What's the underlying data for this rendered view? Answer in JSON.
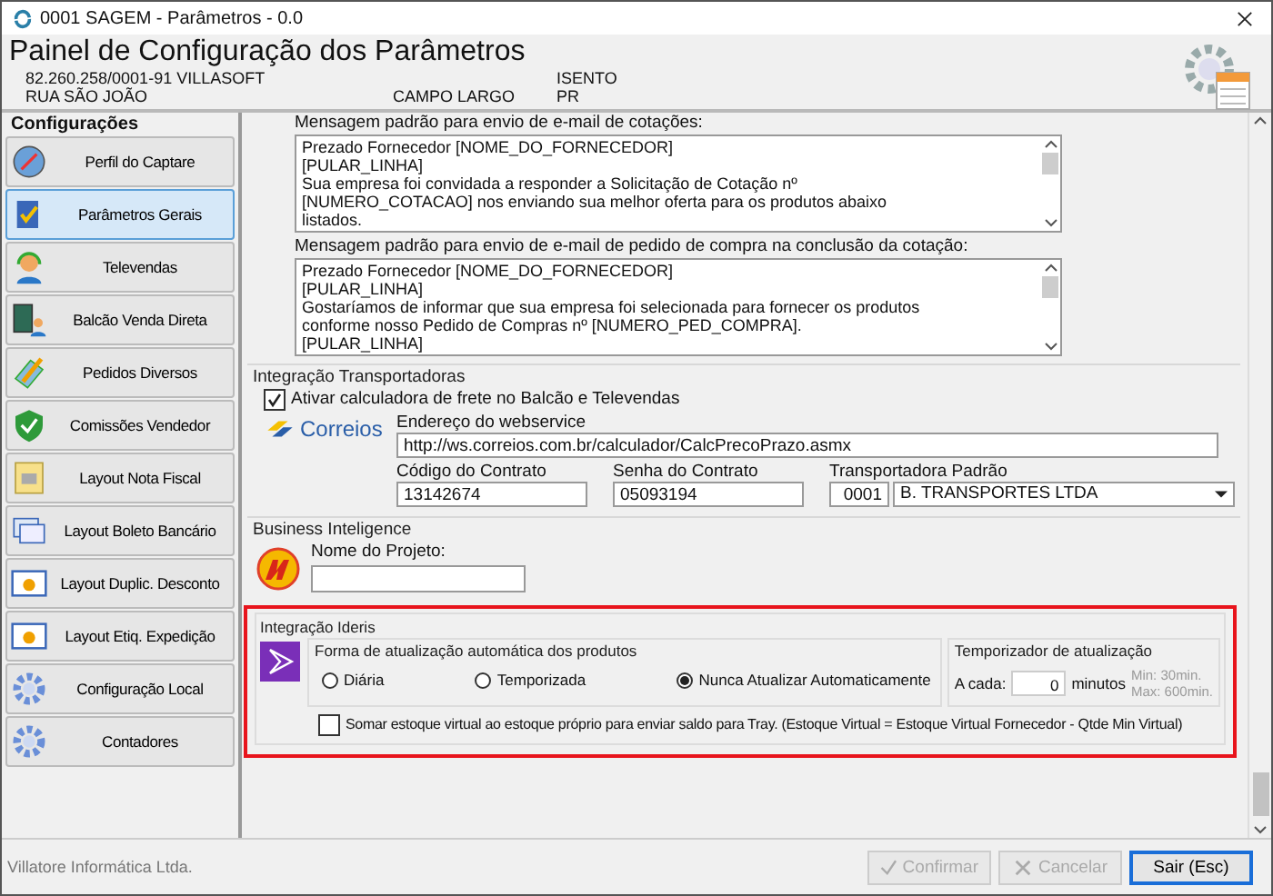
{
  "window": {
    "title": "0001 SAGEM - Parâmetros - 0.0"
  },
  "header": {
    "title": "Painel de Configuração dos Parâmetros",
    "company_id": "82.260.258/0001-91",
    "company_name": "VILLASOFT",
    "tax_status": "ISENTO",
    "street": "RUA SÃO JOÃO",
    "city": "CAMPO LARGO",
    "state": "PR"
  },
  "sidebar": {
    "title": "Configurações",
    "items": [
      {
        "label": "Perfil do Captare",
        "selected": false
      },
      {
        "label": "Parâmetros Gerais",
        "selected": true
      },
      {
        "label": "Televendas",
        "selected": false
      },
      {
        "label": "Balcão Venda Direta",
        "selected": false
      },
      {
        "label": "Pedidos Diversos",
        "selected": false
      },
      {
        "label": "Comissões Vendedor",
        "selected": false
      },
      {
        "label": "Layout Nota Fiscal",
        "selected": false
      },
      {
        "label": "Layout Boleto Bancário",
        "selected": false
      },
      {
        "label": "Layout Duplic. Desconto",
        "selected": false
      },
      {
        "label": "Layout Etiq. Expedição",
        "selected": false
      },
      {
        "label": "Configuração Local",
        "selected": false
      },
      {
        "label": "Contadores",
        "selected": false
      }
    ]
  },
  "messages": [
    {
      "label": "Mensagem padrão para envio de e-mail de cotações:",
      "lines": [
        "Prezado Fornecedor [NOME_DO_FORNECEDOR]",
        "[PULAR_LINHA]",
        "Sua empresa foi convidada a responder a Solicitação de Cotação nº",
        "[NUMERO_COTACAO] nos enviando sua melhor oferta para os produtos abaixo",
        "listados."
      ]
    },
    {
      "label": "Mensagem padrão para envio de e-mail de pedido de compra na conclusão da cotação:",
      "lines": [
        "Prezado Fornecedor [NOME_DO_FORNECEDOR]",
        "[PULAR_LINHA]",
        "Gostaríamos de informar que sua empresa foi selecionada para fornecer os produtos",
        "conforme nosso Pedido de Compras nº [NUMERO_PED_COMPRA].",
        "[PULAR_LINHA]"
      ]
    }
  ],
  "shipping": {
    "title": "Integração Transportadoras",
    "calculator": {
      "label": "Ativar calculadora de frete no Balcão e Televendas",
      "checked": true
    },
    "logo_text": "Correios",
    "webservice": {
      "label": "Endereço do webservice",
      "value": "http://ws.correios.com.br/calculador/CalcPrecoPrazo.asmx"
    },
    "contract_code": {
      "label": "Código do Contrato",
      "value": "13142674"
    },
    "contract_password": {
      "label": "Senha do Contrato",
      "value": "05093194"
    },
    "default_carrier": {
      "label": "Transportadora Padrão",
      "code": "0001",
      "name": "B. TRANSPORTES LTDA"
    }
  },
  "bi": {
    "title": "Business Inteligence",
    "project_label": "Nome do Projeto:"
  },
  "ideris": {
    "title": "Integração Ideris",
    "update_mode": {
      "title": "Forma de atualização automática dos produtos",
      "options": [
        {
          "label": "Diária",
          "selected": false
        },
        {
          "label": "Temporizada",
          "selected": false
        },
        {
          "label": "Nunca Atualizar Automaticamente",
          "selected": true
        }
      ]
    },
    "timer": {
      "title": "Temporizador de atualização",
      "prefix": "A cada:",
      "value": "0",
      "unit": "minutos",
      "min": "Min: 30min.",
      "max": "Max: 600min."
    },
    "virtual_stock": {
      "label": "Somar estoque virtual ao estoque próprio para enviar saldo para Tray. (Estoque Virtual = Estoque Virtual Fornecedor - Qtde Min Virtual)",
      "checked": false
    }
  },
  "footer": {
    "company": "Villatore Informática Ltda.",
    "buttons": [
      {
        "label": "Confirmar",
        "disabled": true
      },
      {
        "label": "Cancelar",
        "disabled": true
      },
      {
        "label": "Sair (Esc)",
        "disabled": false
      }
    ]
  }
}
